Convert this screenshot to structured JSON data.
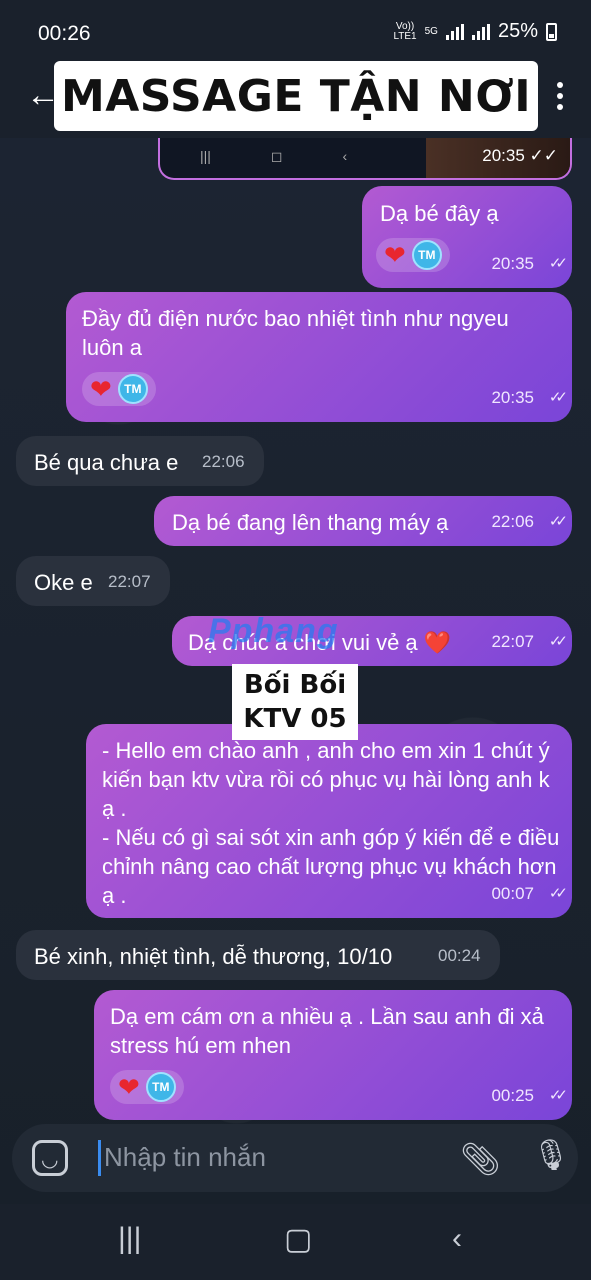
{
  "status_bar": {
    "time": "00:26",
    "carrier_top": "Vo))",
    "carrier_bottom": "LTE1",
    "net": "5G",
    "battery": "25%"
  },
  "header": {
    "title": "MASSAGE TẬN NƠI"
  },
  "top_image_message": {
    "time": "20:35"
  },
  "messages": [
    {
      "dir": "out",
      "text": "Dạ bé đây ạ",
      "time": "20:35"
    },
    {
      "dir": "out",
      "text": "Đầy đủ điện nước bao nhiệt tình như ngyeu luôn a",
      "time": "20:35"
    },
    {
      "dir": "in",
      "text": "Bé qua chưa e",
      "time": "22:06"
    },
    {
      "dir": "out",
      "text": "Dạ bé đang lên thang máy ạ",
      "time": "22:06"
    },
    {
      "dir": "in",
      "text": "Oke e",
      "time": "22:07"
    },
    {
      "dir": "out",
      "text": "Dạ chúc a chơi vui vẻ ạ ❤️",
      "time": "22:07"
    },
    {
      "dir": "out",
      "text": "- Hello em chào anh , anh cho em xin 1 chút ý kiến bạn ktv vừa rồi có phục vụ hài lòng anh k ạ .\n- Nếu có gì sai sót xin anh góp ý kiến để e điều chỉnh nâng cao chất lượng phục vụ khách hơn ạ .",
      "time": "00:07"
    },
    {
      "dir": "in",
      "text": "Bé xinh, nhiệt tình, dễ thương, 10/10",
      "time": "00:24"
    },
    {
      "dir": "out",
      "text": "Dạ em cám ơn a nhiều ạ . Lần sau anh đi xả stress hú em nhen",
      "time": "00:25"
    }
  ],
  "reaction": {
    "heart": "❤",
    "tm": "TM"
  },
  "overlay": {
    "line1": "Bối Bối",
    "line2": "KTV 05",
    "watermark": "Pphang"
  },
  "input": {
    "placeholder": "Nhập tin nhắn"
  },
  "icons": {
    "back": "back-arrow-icon",
    "menu": "kebab-menu-icon",
    "emoji": "emoji-icon",
    "attach": "paperclip-icon",
    "mic": "microphone-icon"
  },
  "colors": {
    "out_bubble": "#9b50d6",
    "in_bubble": "#2a313d",
    "background": "#1b2230"
  }
}
